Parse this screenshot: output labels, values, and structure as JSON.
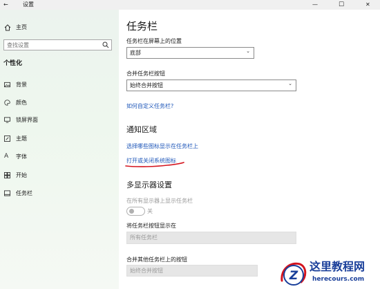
{
  "window": {
    "title": "设置",
    "back": "←",
    "minimize": "—",
    "maximize": "☐",
    "close": "✕"
  },
  "sidebar": {
    "home": "主页",
    "search_placeholder": "查找设置",
    "section": "个性化",
    "items": [
      {
        "label": "背景",
        "icon": "image-icon"
      },
      {
        "label": "颜色",
        "icon": "palette-icon"
      },
      {
        "label": "锁屏界面",
        "icon": "monitor-lock-icon"
      },
      {
        "label": "主题",
        "icon": "theme-brush-icon"
      },
      {
        "label": "字体",
        "icon": "font-icon"
      },
      {
        "label": "开始",
        "icon": "start-grid-icon"
      },
      {
        "label": "任务栏",
        "icon": "taskbar-icon"
      }
    ]
  },
  "main": {
    "title": "任务栏",
    "position_label": "任务栏在屏幕上的位置",
    "position_value": "底部",
    "combine_label": "合并任务栏按钮",
    "combine_value": "始终合并按钮",
    "customize_link": "如何自定义任务栏?",
    "notify_title": "通知区域",
    "notify_link1": "选择哪些图标显示在任务栏上",
    "notify_link2": "打开或关闭系统图标",
    "multi_title": "多显示器设置",
    "show_all_label": "在所有显示器上显示任务栏",
    "toggle_state": "关",
    "show_buttons_label": "将任务栏按钮显示在",
    "show_buttons_value": "所有任务栏",
    "combine_other_label": "合并其他任务栏上的按钮",
    "combine_other_value": "始终合并按钮"
  },
  "watermark": {
    "logo_letter": "Z",
    "site_name": "这里教程网",
    "domain": "herecours.com"
  },
  "colors": {
    "accent_link": "#1c55b8",
    "annotation_red": "#d4141e",
    "watermark_blue": "#1a3f9a"
  }
}
